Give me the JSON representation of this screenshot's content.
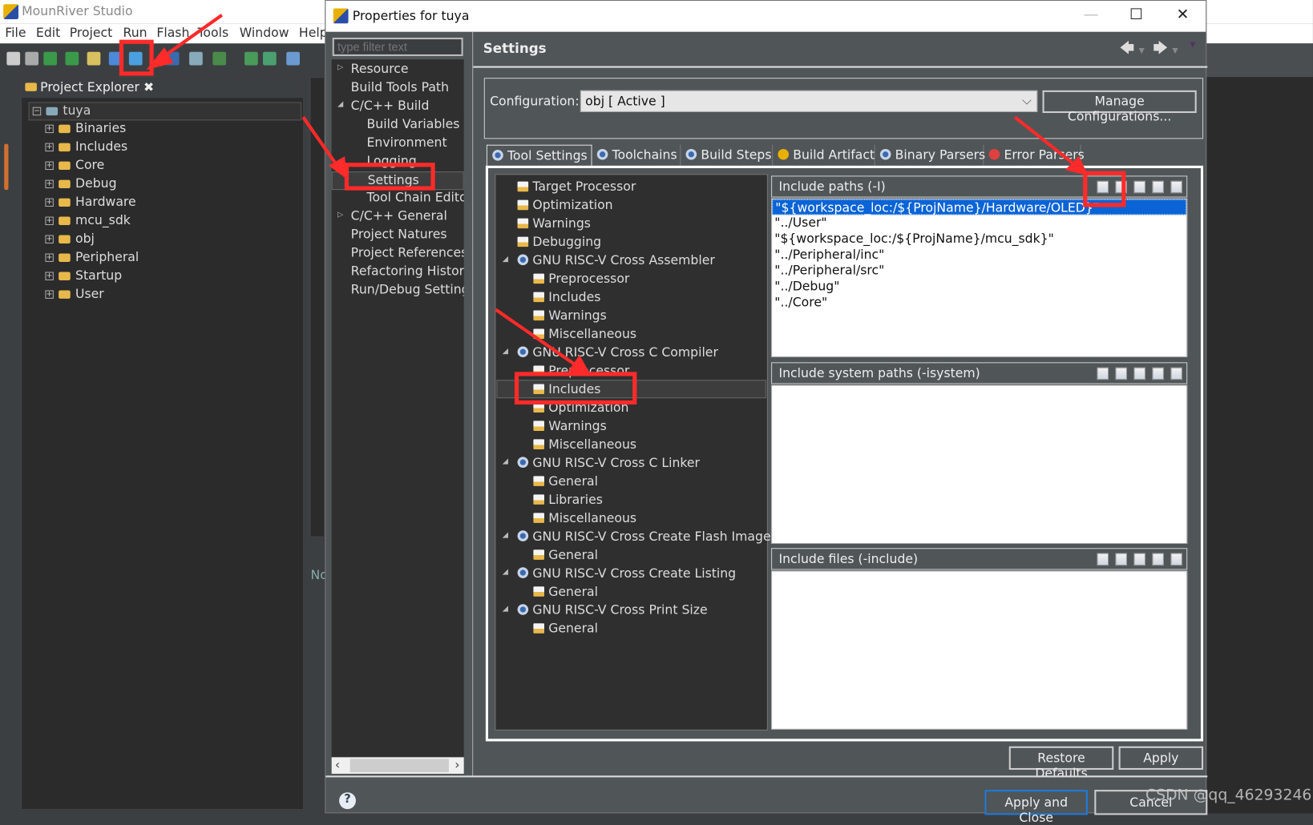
{
  "ide": {
    "title": "MounRiver Studio",
    "menu": [
      "File",
      "Edit",
      "Project",
      "Run",
      "Flash",
      "Tools",
      "Window",
      "Help"
    ],
    "project_explorer": {
      "title": "Project Explorer",
      "root": "tuya",
      "items": [
        "Binaries",
        "Includes",
        "Core",
        "Debug",
        "Hardware",
        "mcu_sdk",
        "obj",
        "Peripheral",
        "Startup",
        "User"
      ]
    },
    "side_tab_label": "No"
  },
  "dialog": {
    "title": "Properties for tuya",
    "filter_placeholder": "type filter text",
    "nav": [
      {
        "label": "Resource",
        "level": 0,
        "exp": "collapsed"
      },
      {
        "label": "Build Tools Path",
        "level": 0
      },
      {
        "label": "C/C++ Build",
        "level": 0,
        "exp": "expanded"
      },
      {
        "label": "Build Variables",
        "level": 1
      },
      {
        "label": "Environment",
        "level": 1
      },
      {
        "label": "Logging",
        "level": 1
      },
      {
        "label": "Settings",
        "level": 1,
        "selected": true
      },
      {
        "label": "Tool Chain Editor",
        "level": 1
      },
      {
        "label": "C/C++ General",
        "level": 0,
        "exp": "collapsed"
      },
      {
        "label": "Project Natures",
        "level": 0
      },
      {
        "label": "Project References",
        "level": 0
      },
      {
        "label": "Refactoring History",
        "level": 0
      },
      {
        "label": "Run/Debug Settings",
        "level": 0
      }
    ],
    "page_title": "Settings",
    "config_label": "Configuration:",
    "config_value": "obj  [ Active ]",
    "manage_button": "Manage Configurations...",
    "tabs": [
      "Tool Settings",
      "Toolchains",
      "Build Steps",
      "Build Artifact",
      "Binary Parsers",
      "Error Parsers"
    ],
    "tool_tree": [
      {
        "label": "Target Processor",
        "level": 0
      },
      {
        "label": "Optimization",
        "level": 0
      },
      {
        "label": "Warnings",
        "level": 0
      },
      {
        "label": "Debugging",
        "level": 0
      },
      {
        "label": "GNU RISC-V Cross Assembler",
        "level": 0,
        "tool": true
      },
      {
        "label": "Preprocessor",
        "level": 1
      },
      {
        "label": "Includes",
        "level": 1
      },
      {
        "label": "Warnings",
        "level": 1
      },
      {
        "label": "Miscellaneous",
        "level": 1
      },
      {
        "label": "GNU RISC-V Cross C Compiler",
        "level": 0,
        "tool": true
      },
      {
        "label": "Preprocessor",
        "level": 1
      },
      {
        "label": "Includes",
        "level": 1,
        "selected": true
      },
      {
        "label": "Optimization",
        "level": 1
      },
      {
        "label": "Warnings",
        "level": 1
      },
      {
        "label": "Miscellaneous",
        "level": 1
      },
      {
        "label": "GNU RISC-V Cross C Linker",
        "level": 0,
        "tool": true
      },
      {
        "label": "General",
        "level": 1
      },
      {
        "label": "Libraries",
        "level": 1
      },
      {
        "label": "Miscellaneous",
        "level": 1
      },
      {
        "label": "GNU RISC-V Cross Create Flash Image",
        "level": 0,
        "tool": true
      },
      {
        "label": "General",
        "level": 1
      },
      {
        "label": "GNU RISC-V Cross Create Listing",
        "level": 0,
        "tool": true
      },
      {
        "label": "General",
        "level": 1
      },
      {
        "label": "GNU RISC-V Cross Print Size",
        "level": 0,
        "tool": true
      },
      {
        "label": "General",
        "level": 1
      }
    ],
    "panels": [
      {
        "title": "Include paths (-I)",
        "items": [
          "\"${workspace_loc:/${ProjName}/Hardware/OLED}\"",
          "\"../User\"",
          "\"${workspace_loc:/${ProjName}/mcu_sdk}\"",
          "\"../Peripheral/inc\"",
          "\"../Peripheral/src\"",
          "\"../Debug\"",
          "\"../Core\""
        ]
      },
      {
        "title": "Include system paths (-isystem)",
        "items": []
      },
      {
        "title": "Include files (-include)",
        "items": []
      }
    ],
    "panel_icons": [
      "add-icon",
      "delete-icon",
      "edit-icon",
      "move-up-icon",
      "move-down-icon"
    ],
    "restore_defaults": "Restore Defaults",
    "apply": "Apply",
    "apply_and_close": "Apply and Close",
    "cancel": "Cancel"
  },
  "watermark": "CSDN @qq_46293246",
  "colors": {
    "annotation": "#ff2a2a",
    "selection": "#0a64d6"
  }
}
